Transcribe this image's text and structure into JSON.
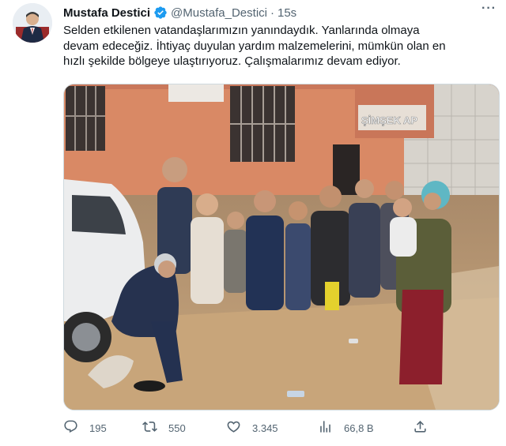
{
  "tweet": {
    "author_name": "Mustafa Destici",
    "handle": "@Mustafa_Destici",
    "separator": "·",
    "time": "15s",
    "text_lines": [
      "Selden etkilenen vatandaşlarımızın yanındaydık. Yanlarında olmaya",
      "devam edeceğiz. İhtiyaç duyulan yardım malzemelerini, mümkün olan en",
      "hızlı şekilde bölgeye ulaştırıyoruz. Çalışmalarımız devam ediyor."
    ],
    "photo": {
      "sign_text": "ŞİMŞEK AP"
    },
    "actions": {
      "replies": "195",
      "retweets": "550",
      "likes": "3.345",
      "views": "66,8 B"
    },
    "more_label": "···"
  },
  "colors": {
    "text": "#0f1419",
    "secondary": "#536471",
    "verified": "#1d9bf0"
  },
  "icons": [
    "verified-badge-icon",
    "more-icon",
    "reply-icon",
    "retweet-icon",
    "like-icon",
    "views-icon",
    "share-icon"
  ]
}
